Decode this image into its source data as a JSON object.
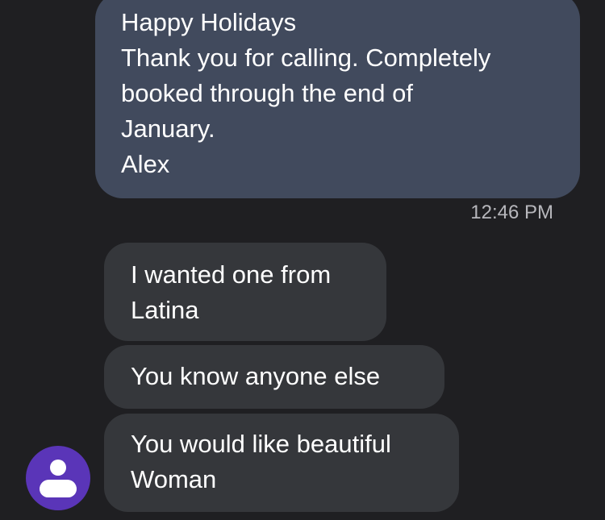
{
  "conversation": {
    "sent_message": {
      "lines": [
        "Happy Holidays",
        "Thank you for calling. Completely",
        "booked through the end of",
        "January.",
        "Alex"
      ],
      "timestamp": "12:46 PM"
    },
    "received_messages": [
      {
        "lines": [
          "I wanted one from",
          "Latina"
        ]
      },
      {
        "lines": [
          "You know anyone else"
        ]
      },
      {
        "lines": [
          "You would like beautiful",
          "Woman"
        ]
      }
    ],
    "contact_avatar": {
      "icon": "person-icon",
      "color": "#5a35b8"
    }
  },
  "colors": {
    "background": "#1f1f22",
    "sent_bubble": "#414a5d",
    "received_bubble": "#35373b",
    "timestamp_text": "#b7b7bc"
  }
}
